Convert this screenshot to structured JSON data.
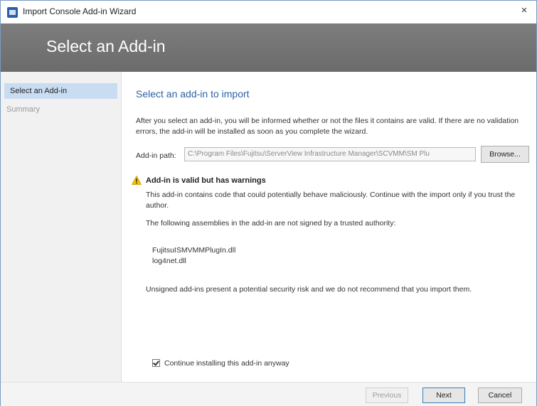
{
  "window": {
    "title": "Import Console Add-in Wizard",
    "close_glyph": "×"
  },
  "banner": {
    "title": "Select an Add-in"
  },
  "sidebar": {
    "items": [
      {
        "label": "Select an Add-in",
        "state": "active"
      },
      {
        "label": "Summary",
        "state": "inactive"
      }
    ]
  },
  "main": {
    "heading": "Select an add-in to import",
    "intro": "After you select an add-in, you will be informed whether or not the files it contains are valid. If there are no validation errors, the add-in will be installed as soon as you complete the wizard.",
    "path_label": "Add-in path:",
    "path_value": "C:\\Program Files\\Fujitsu\\ServerView Infrastructure Manager\\SCVMM\\SM Plu",
    "browse_label": "Browse...",
    "warning": {
      "icon": "warning-icon",
      "color": "#f2c200",
      "title": "Add-in is valid but has warnings",
      "description": "This add-in contains code that could potentially behave maliciously. Continue with the import only if you trust the author.",
      "assemblies_intro": "The following assemblies in the add-in are not signed by a trusted authority:",
      "assemblies": [
        "FujitsuISMVMMPlugIn.dll",
        "log4net.dll"
      ],
      "unsigned_note": "Unsigned add-ins present a potential security risk and we do not recommend that you import them."
    },
    "continue_checkbox": {
      "label": "Continue installing this add-in anyway",
      "checked": true
    }
  },
  "footer": {
    "previous_label": "Previous",
    "next_label": "Next",
    "cancel_label": "Cancel"
  },
  "colors": {
    "banner": "#737373",
    "heading": "#2d63a6",
    "sidebar_selected": "#c9ddf2"
  }
}
